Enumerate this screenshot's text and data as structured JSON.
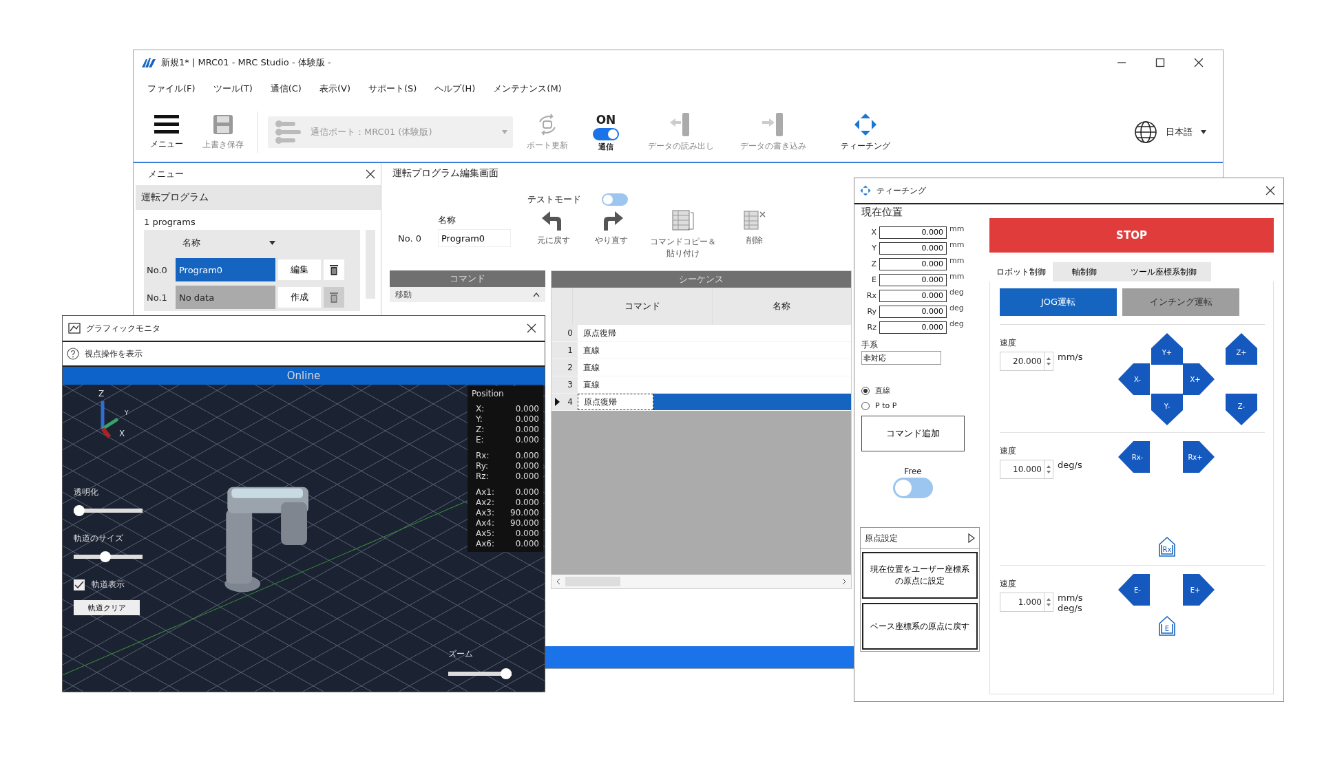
{
  "main_window": {
    "title": "新規1* | MRC01 - MRC Studio - 体験版 -",
    "menu": [
      "ファイル(F)",
      "ツール(T)",
      "通信(C)",
      "表示(V)",
      "サポート(S)",
      "ヘルプ(H)",
      "メンテナンス(M)"
    ],
    "toolbar": {
      "menu_button": "メニュー",
      "save_button": "上書き保存",
      "port": "通信ポート：MRC01 (体験版)",
      "refresh_button": "ポート更新",
      "comm": {
        "state_label": "ON",
        "label": "通信",
        "on": true
      },
      "read_button": "データの読み出し",
      "write_button": "データの書き込み",
      "teach_button": "ティーチング",
      "language": "日本語"
    }
  },
  "menu_panel": {
    "title": "メニュー",
    "section": "運転プログラム",
    "count": "1 programs",
    "column": "名称",
    "programs": [
      {
        "no": "No.0",
        "name": "Program0",
        "action": "編集",
        "selected": true
      },
      {
        "no": "No.1",
        "name": "No data",
        "action": "作成",
        "selected": false
      }
    ]
  },
  "editor": {
    "title": "運転プログラム編集画面",
    "test_mode": {
      "label": "テストモード",
      "on": false
    },
    "name_label": "名称",
    "number": "No. 0",
    "name": "Program0",
    "tools": [
      {
        "kind": "undo",
        "label": "元に戻す"
      },
      {
        "kind": "redo",
        "label": "やり直す"
      },
      {
        "kind": "copy",
        "label": "コマンドコピー＆貼り付け"
      },
      {
        "kind": "delete",
        "label": "削除"
      }
    ],
    "command_header": "コマンド",
    "commands": [
      "移動"
    ],
    "sequence": {
      "title": "シーケンス",
      "columns": [
        "コマンド",
        "名称"
      ],
      "rows": [
        {
          "index": "0",
          "command": "原点復帰",
          "selected": false
        },
        {
          "index": "1",
          "command": "直線",
          "selected": false
        },
        {
          "index": "2",
          "command": "直線",
          "selected": false
        },
        {
          "index": "3",
          "command": "直線",
          "selected": false
        },
        {
          "index": "4",
          "command": "原点復帰",
          "selected": true
        }
      ]
    }
  },
  "graphic_monitor": {
    "title": "グラフィックモニタ",
    "help": "視点操作を表示",
    "status": "Online",
    "axes": [
      "Z",
      "Y",
      "X"
    ],
    "position": {
      "title": "Position",
      "groups": [
        [
          {
            "label": "X:",
            "value": "0.000"
          },
          {
            "label": "Y:",
            "value": "0.000"
          },
          {
            "label": "Z:",
            "value": "0.000"
          },
          {
            "label": "E:",
            "value": "0.000"
          }
        ],
        [
          {
            "label": "Rx:",
            "value": "0.000"
          },
          {
            "label": "Ry:",
            "value": "0.000"
          },
          {
            "label": "Rz:",
            "value": "0.000"
          }
        ],
        [
          {
            "label": "Ax1:",
            "value": "0.000"
          },
          {
            "label": "Ax2:",
            "value": "0.000"
          },
          {
            "label": "Ax3:",
            "value": "90.000"
          },
          {
            "label": "Ax4:",
            "value": "90.000"
          },
          {
            "label": "Ax5:",
            "value": "0.000"
          },
          {
            "label": "Ax6:",
            "value": "0.000"
          }
        ]
      ]
    },
    "sliders": [
      {
        "label": "透明化",
        "level": 0
      },
      {
        "label": "軌道のサイズ",
        "level": 0.45
      }
    ],
    "trail": {
      "label": "軌道表示",
      "checked": true
    },
    "clear_button": "軌道クリア",
    "zoom": {
      "label": "ズーム",
      "level": 1
    }
  },
  "teaching": {
    "title": "ティーチング",
    "position_heading": "現在位置",
    "positions": [
      {
        "axis": "X",
        "value": "0.000",
        "unit": "mm"
      },
      {
        "axis": "Y",
        "value": "0.000",
        "unit": "mm"
      },
      {
        "axis": "Z",
        "value": "0.000",
        "unit": "mm"
      },
      {
        "axis": "E",
        "value": "0.000",
        "unit": "mm"
      },
      {
        "axis": "Rx",
        "value": "0.000",
        "unit": "deg"
      },
      {
        "axis": "Ry",
        "value": "0.000",
        "unit": "deg"
      },
      {
        "axis": "Rz",
        "value": "0.000",
        "unit": "deg"
      }
    ],
    "hand_label": "手系",
    "hand_value": "非対応",
    "motions": [
      {
        "label": "直線",
        "selected": true
      },
      {
        "label": "P to P",
        "selected": false
      }
    ],
    "add_button": "コマンド追加",
    "free": {
      "label": "Free",
      "on": false
    },
    "origin": {
      "title": "原点設定",
      "buttons": [
        "現在位置をユーザー座標系の原点に設定",
        "ベース座標系の原点に戻す"
      ]
    },
    "stop": "STOP",
    "tabs": [
      {
        "label": "ロボット制御",
        "selected": true
      },
      {
        "label": "軸制御",
        "selected": false
      },
      {
        "label": "ツール座標系制御",
        "selected": false
      }
    ],
    "modes": [
      {
        "label": "JOG運転",
        "selected": true
      },
      {
        "label": "インチング運転",
        "selected": false
      }
    ],
    "sections": [
      {
        "label": "速度",
        "value": "20.000",
        "units": [
          "mm/s"
        ],
        "buttons": [
          {
            "kind": "up",
            "label": "Y+"
          },
          {
            "kind": "up",
            "label": "Z+"
          },
          {
            "kind": "left",
            "label": "X-"
          },
          {
            "kind": "right",
            "label": "X+"
          },
          {
            "kind": "down",
            "label": "Y-"
          },
          {
            "kind": "down",
            "label": "Z-"
          }
        ]
      },
      {
        "label": "速度",
        "value": "10.000",
        "units": [
          "deg/s"
        ],
        "buttons": [
          {
            "kind": "left",
            "label": "Rx-"
          },
          {
            "kind": "right",
            "label": "Rx+"
          },
          {
            "kind": "home",
            "label": "Rx"
          }
        ]
      },
      {
        "label": "速度",
        "value": "1.000",
        "units": [
          "mm/s",
          "deg/s"
        ],
        "buttons": [
          {
            "kind": "left",
            "label": "E-"
          },
          {
            "kind": "right",
            "label": "E+"
          },
          {
            "kind": "home",
            "label": "E"
          }
        ]
      }
    ]
  }
}
